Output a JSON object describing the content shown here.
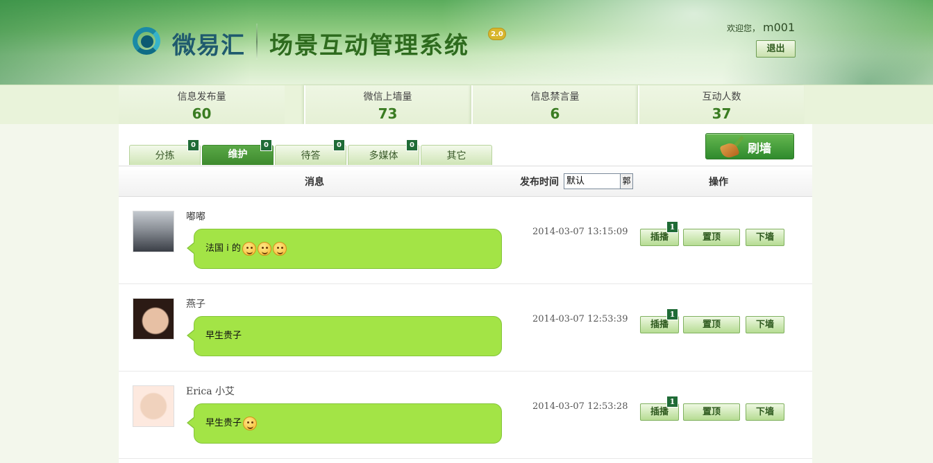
{
  "header": {
    "brand": "微易汇",
    "system_title": "场景互动管理系统",
    "version": "2.0",
    "welcome": "欢迎您，",
    "username": "m001",
    "logout_label": "退出"
  },
  "stats": [
    {
      "label": "信息发布量",
      "value": "60"
    },
    {
      "label": "微信上墙量",
      "value": "73"
    },
    {
      "label": "信息禁言量",
      "value": "6"
    },
    {
      "label": "互动人数",
      "value": "37"
    }
  ],
  "tabs": [
    {
      "label": "分拣",
      "count": "0",
      "active": false
    },
    {
      "label": "维护",
      "count": "0",
      "active": true
    },
    {
      "label": "待答",
      "count": "0",
      "active": false
    },
    {
      "label": "多媒体",
      "count": "0",
      "active": false
    },
    {
      "label": "其它",
      "count": "",
      "active": false
    }
  ],
  "refresh_label": "刷墙",
  "table": {
    "col_message": "消息",
    "col_time": "发布时间",
    "time_filter_value": "默认",
    "time_filter_arrow": "郭",
    "col_ops": "操作"
  },
  "messages": [
    {
      "user": "嘟嘟",
      "text": "法国 i 的",
      "emoji_count": 3,
      "time": "2014-03-07 13:15:09",
      "insert_count": "1"
    },
    {
      "user": "燕子",
      "text": "早生贵子",
      "emoji_count": 0,
      "time": "2014-03-07 12:53:39",
      "insert_count": "1"
    },
    {
      "user": "Erica 小艾",
      "text": "早生贵子",
      "emoji_count": 1,
      "time": "2014-03-07 12:53:28",
      "insert_count": "1"
    }
  ],
  "ops": {
    "insert_label": "插播",
    "pin_label": "置顶",
    "down_label": "下墙"
  }
}
